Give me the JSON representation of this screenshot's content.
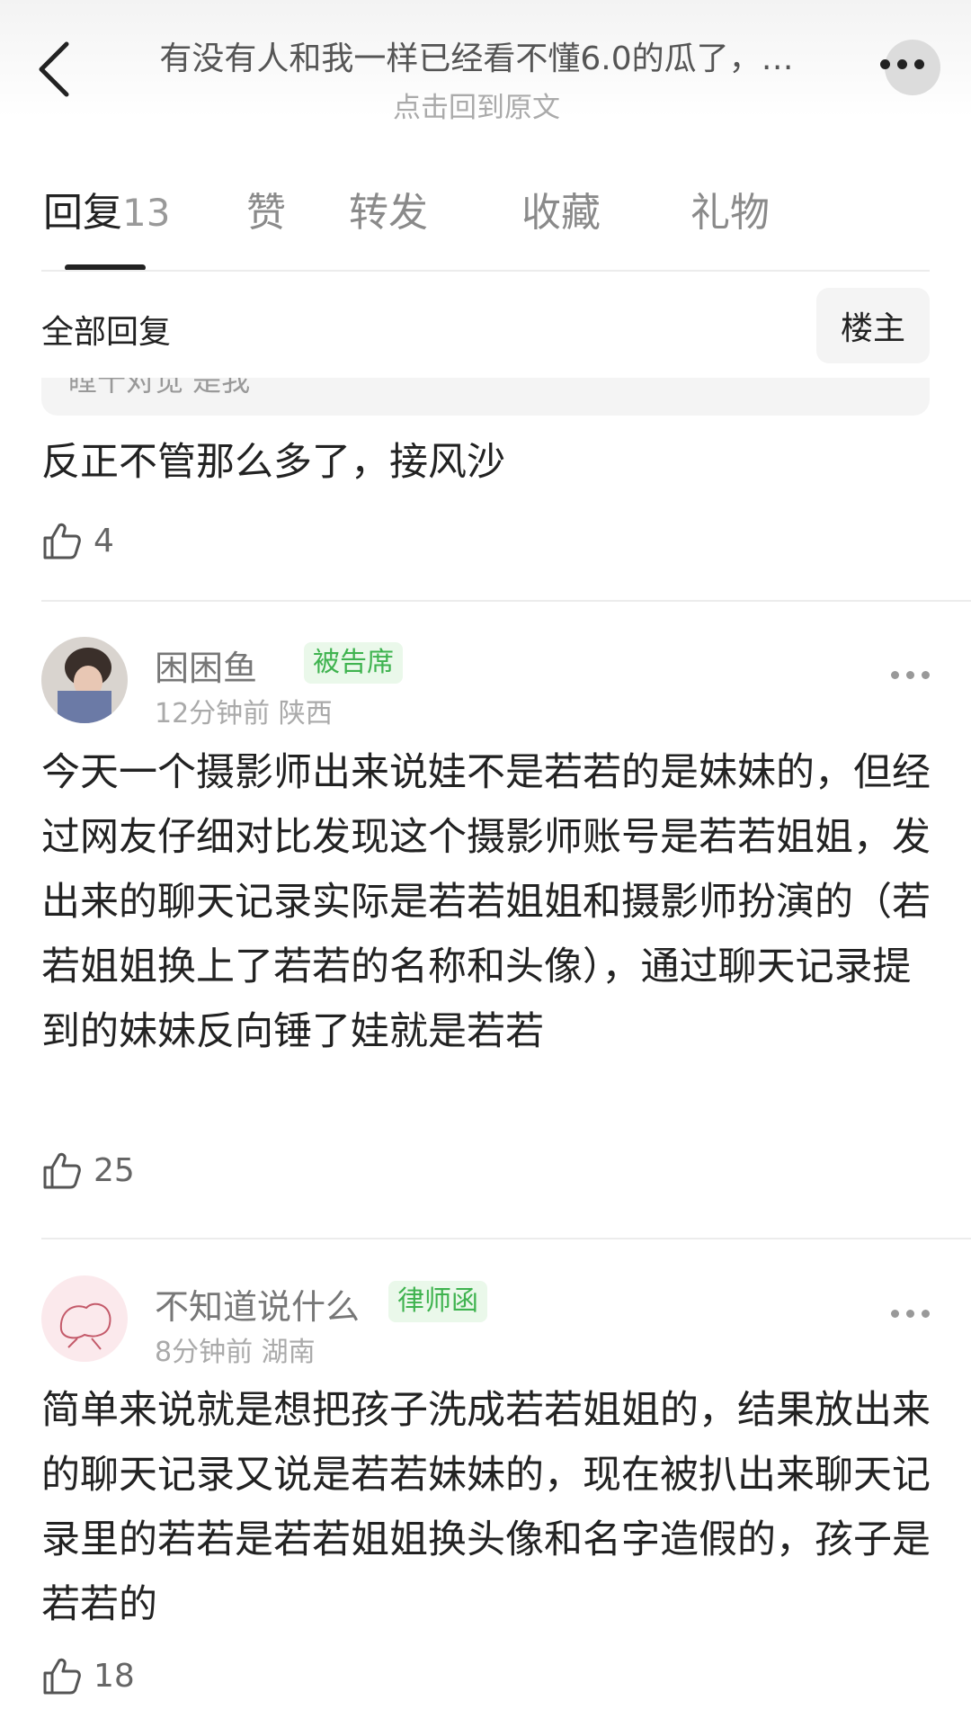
{
  "header": {
    "title": "有没有人和我一样已经看不懂6.0的瓜了，…",
    "subtitle": "点击回到原文"
  },
  "tabs": [
    {
      "label": "回复",
      "count": "13"
    },
    {
      "label": "赞"
    },
    {
      "label": "转发"
    },
    {
      "label": "收藏"
    },
    {
      "label": "礼物"
    }
  ],
  "reply_filter": {
    "label": "全部回复",
    "owner_button": "楼主"
  },
  "quoted_fragment": "瞠十对觉 是我",
  "top_reply": {
    "text": "反正不管那么多了，接风沙",
    "likes": "4"
  },
  "comments": [
    {
      "username": "困困鱼",
      "badge": "被告席",
      "time": "12分钟前",
      "location": "陕西",
      "text": "今天一个摄影师出来说娃不是若若的是妹妹的，但经过网友仔细对比发现这个摄影师账号是若若姐姐，发出来的聊天记录实际是若若姐姐和摄影师扮演的（若若姐姐换上了若若的名称和头像），通过聊天记录提到的妹妹反向锤了娃就是若若",
      "likes": "25"
    },
    {
      "username": "不知道说什么",
      "badge": "律师函",
      "time": "8分钟前",
      "location": "湖南",
      "text": "简单来说就是想把孩子洗成若若姐姐的，结果放出来的聊天记录又说是若若妹妹的，现在被扒出来聊天记录里的若若是若若姐姐换头像和名字造假的，孩子是若若的",
      "likes": "18"
    }
  ],
  "colors": {
    "badge_green": "#3fb34f",
    "badge_bg": "#eaf8ea",
    "text": "#222222",
    "muted": "#aaaaaa"
  }
}
